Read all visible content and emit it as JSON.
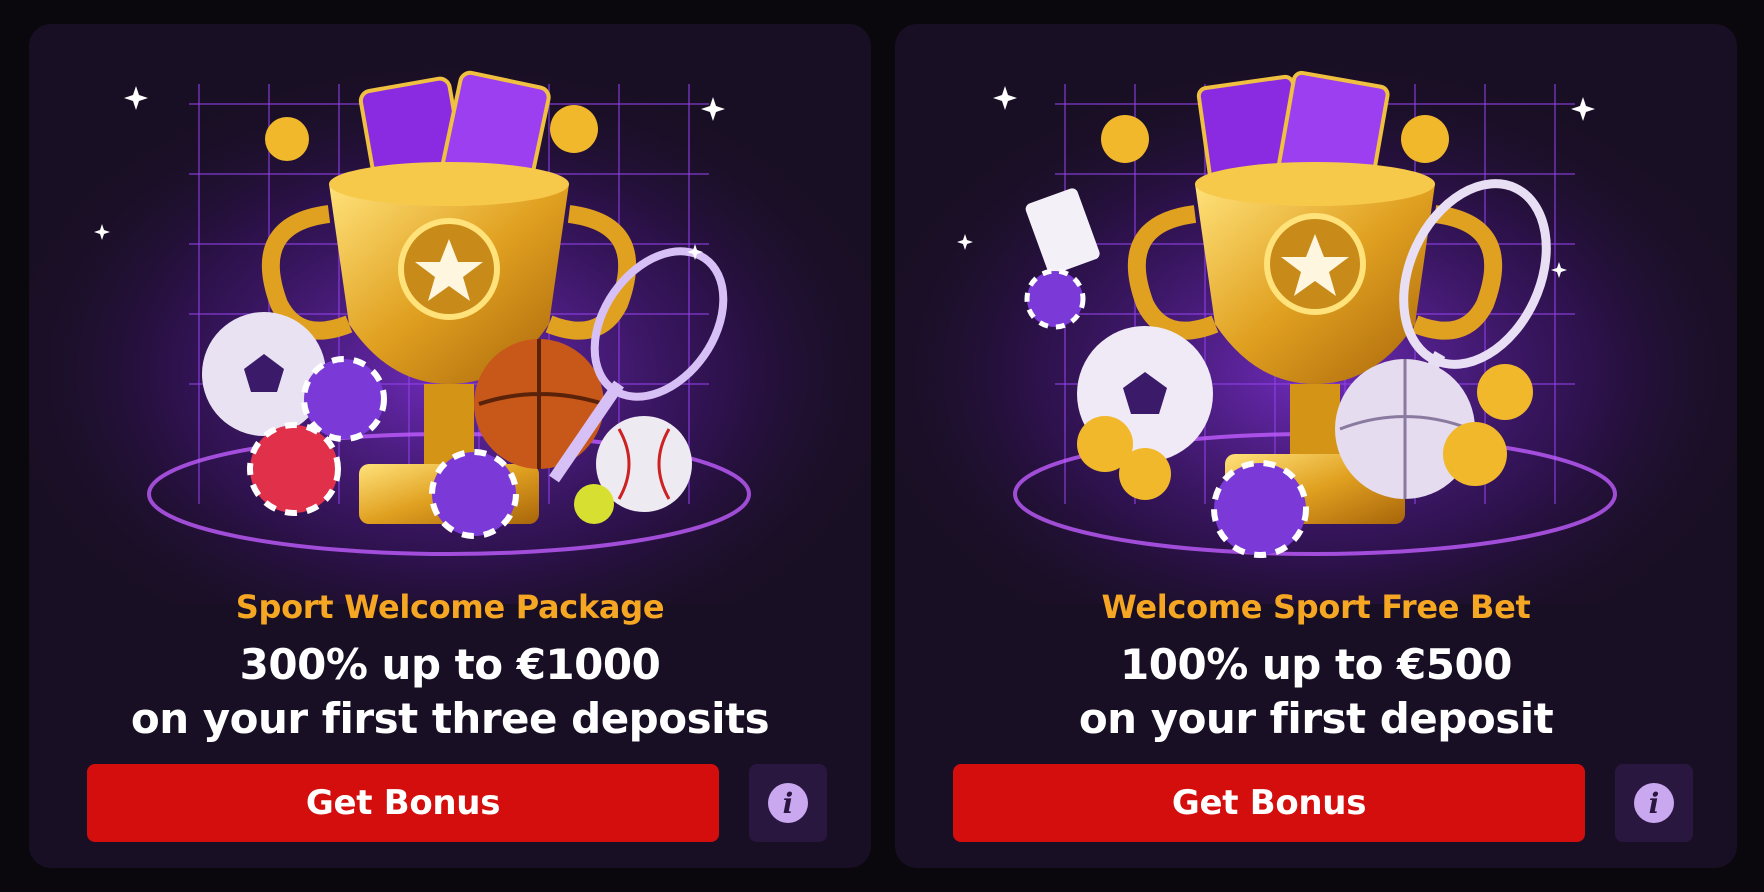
{
  "colors": {
    "accent": "#f5a623",
    "cta": "#d40d0d",
    "card": "#190f24",
    "info_bg": "#2a1740"
  },
  "offers": [
    {
      "subtitle": "Sport Welcome Package",
      "headline_line1": "300% up to €1000",
      "headline_line2": "on your first three deposits",
      "cta_label": "Get Bonus",
      "info_glyph": "i",
      "illustration_icon": "trophy-sports-illustration"
    },
    {
      "subtitle": "Welcome Sport Free Bet",
      "headline_line1": "100% up to €500",
      "headline_line2": "on your first deposit",
      "cta_label": "Get Bonus",
      "info_glyph": "i",
      "illustration_icon": "trophy-sports-illustration"
    }
  ]
}
